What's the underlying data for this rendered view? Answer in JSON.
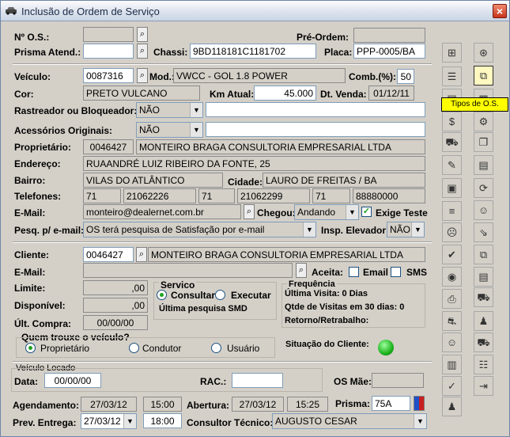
{
  "window": {
    "title": "Inclusão de Ordem de Serviço",
    "close": "×",
    "car_icon": "car-icon"
  },
  "os": {
    "label": "Nº O.S.:",
    "value": ""
  },
  "pre_ordem": {
    "label": "Pré-Ordem:",
    "value": ""
  },
  "prisma_atend": {
    "label": "Prisma Atend.:",
    "value": ""
  },
  "chassi": {
    "label": "Chassi:",
    "value": "9BD118181C1181702"
  },
  "placa": {
    "label": "Placa:",
    "value": "PPP-0005/BA"
  },
  "veiculo": {
    "label": "Veículo:",
    "value": "0087316"
  },
  "mod": {
    "label": "Mod.:",
    "value": "VWCC - GOL 1.8 POWER"
  },
  "comb": {
    "label": "Comb.(%):",
    "value": "50"
  },
  "cor": {
    "label": "Cor:",
    "value": "PRETO VULCANO"
  },
  "km_atual": {
    "label": "Km Atual:",
    "value": "45.000"
  },
  "dt_venda": {
    "label": "Dt. Venda:",
    "value": "01/12/11"
  },
  "rastreador": {
    "label": "Rastreador ou Bloqueador:",
    "value": "NÃO",
    "extra": ""
  },
  "acessorios": {
    "label": "Acessórios Originais:",
    "value": "NÃO",
    "extra": ""
  },
  "proprietario": {
    "label": "Proprietário:",
    "code": "0046427",
    "name": "MONTEIRO BRAGA CONSULTORIA EMPRESARIAL LTDA"
  },
  "endereco": {
    "label": "Endereço:",
    "value": "RUAANDRÉ LUIZ RIBEIRO DA FONTE, 25"
  },
  "bairro": {
    "label": "Bairro:",
    "value": "VILAS DO ATLÂNTICO"
  },
  "cidade": {
    "label": "Cidade:",
    "value": "LAURO DE FREITAS / BA"
  },
  "telefones": {
    "label": "Telefones:",
    "ddd1": "71",
    "tel1": "21062226",
    "ddd2": "71",
    "tel2": "21062299",
    "ddd3": "71",
    "tel3": "88880000"
  },
  "email": {
    "label": "E-Mail:",
    "value": "monteiro@dealernet.com.br"
  },
  "chegou": {
    "label": "Chegou:",
    "value": "Andando"
  },
  "exige_teste": {
    "label": "Exige Teste",
    "checked": true
  },
  "pesq_email": {
    "label": "Pesq. p/ e-mail:",
    "value": "OS terá pesquisa de Satisfação por e-mail"
  },
  "insp_elevador": {
    "label": "Insp. Elevador:",
    "value": "NÃO"
  },
  "cliente": {
    "label": "Cliente:",
    "code": "0046427",
    "name": "MONTEIRO BRAGA CONSULTORIA EMPRESARIAL LTDA"
  },
  "cli_email": {
    "label": "E-Mail:",
    "value": ""
  },
  "aceita": {
    "label": "Aceita:",
    "email_label": "Email",
    "sms_label": "SMS"
  },
  "limite": {
    "label": "Limite:",
    "value": ",00"
  },
  "disponivel": {
    "label": "Disponível:",
    "value": ",00"
  },
  "ult_compra": {
    "label": "Últ. Compra:",
    "value": "00/00/00"
  },
  "servico": {
    "title": "Servico",
    "consultar": "Consultar",
    "executar": "Executar",
    "ultima": "Última pesquisa SMD"
  },
  "frequencia": {
    "title": "Frequência",
    "ultima_visita": "Última Visita: 0 Dias",
    "qtde": "Qtde de Visitas em 30 dias: 0",
    "retorno": "Retorno/Retrabalho:"
  },
  "quem_trouxe": {
    "title": "Quem trouxe o veículo?",
    "opt1": "Proprietário",
    "opt2": "Condutor",
    "opt3": "Usuário"
  },
  "situacao": {
    "label": "Situação do Cliente:",
    "color": "#1eb31e"
  },
  "veiculo_locado": {
    "title": "Veículo Locado",
    "data_label": "Data:",
    "data": "00/00/00",
    "rac_label": "RAC.:",
    "rac": "",
    "os_mae_label": "OS Mãe:",
    "os_mae": ""
  },
  "agendamento": {
    "label": "Agendamento:",
    "date": "27/03/12",
    "time": "15:00"
  },
  "abertura": {
    "label": "Abertura:",
    "date": "27/03/12",
    "time": "15:25"
  },
  "prisma": {
    "label": "Prisma:",
    "value": "75A"
  },
  "prev_entrega": {
    "label": "Prev. Entrega:",
    "date": "27/03/12",
    "time": "18:00"
  },
  "consultor": {
    "label": "Consultor Técnico:",
    "value": "AUGUSTO CESAR"
  },
  "tooltip": "Tipos de O.S.",
  "toolbar": {
    "left": [
      "tree-icon",
      "list-icon",
      "doc-icon",
      "dollar-icon",
      "person-car-icon",
      "clipboard-icon",
      "toolbox-icon",
      "lines-icon",
      "sad-face-icon",
      "pencil-icon",
      "camera-icon",
      "printer-icon",
      "car-red-icon",
      "mask-icon",
      "layers-icon",
      "checkmark-icon",
      "person-icon"
    ],
    "right": [
      "money-bag-icon",
      "copy-active-icon",
      "disc-icon",
      "tools-icon",
      "pages-icon",
      "clipboard2-icon",
      "refresh-icon",
      "smiley-icon",
      "hose-icon",
      "copy2-icon",
      "note-icon",
      "car-blue-icon",
      "stamp-icon",
      "truck-icon",
      "checklist-icon",
      "exit-icon"
    ]
  }
}
